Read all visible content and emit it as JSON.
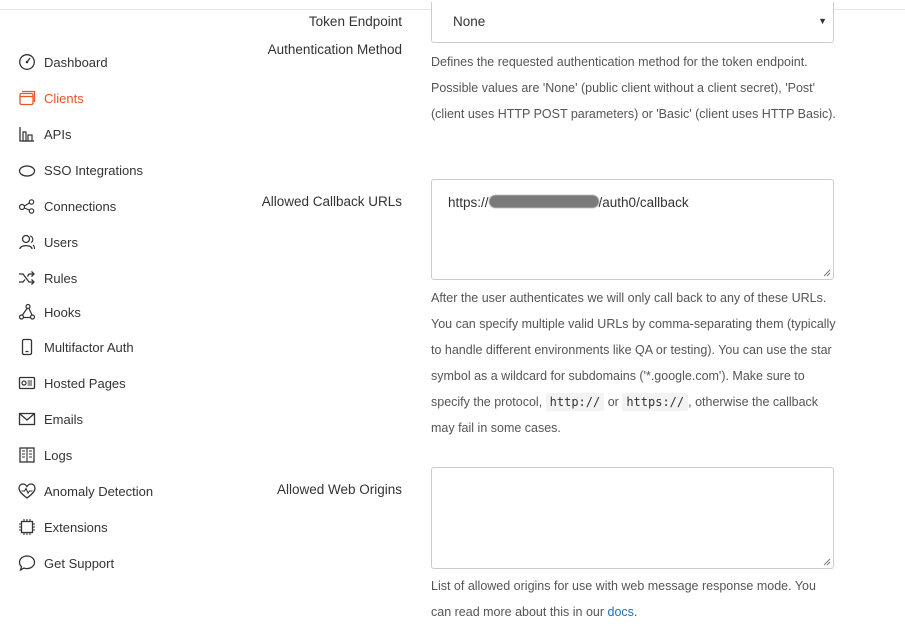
{
  "nav": {
    "dashboard": "Dashboard",
    "clients": "Clients",
    "apis": "APIs",
    "sso": "SSO Integrations",
    "connections": "Connections",
    "users": "Users",
    "rules": "Rules",
    "hooks": "Hooks",
    "multifactor": "Multifactor Auth",
    "hosted_pages": "Hosted Pages",
    "emails": "Emails",
    "logs": "Logs",
    "anomaly": "Anomaly Detection",
    "extensions": "Extensions",
    "support": "Get Support"
  },
  "colors": {
    "active_nav": "#eb5424",
    "link": "#1f6fb5"
  },
  "token_endpoint": {
    "label_line1": "Token Endpoint",
    "label_line2": "Authentication Method",
    "selected": "None",
    "help": "Defines the requested authentication method for the token endpoint. Possible values are 'None' (public client without a client secret), 'Post' (client uses HTTP POST parameters) or 'Basic' (client uses HTTP Basic)."
  },
  "callbacks": {
    "label": "Allowed Callback URLs",
    "value_prefix": "https://",
    "value_suffix": "/auth0/callback",
    "help_part1": "After the user authenticates we will only call back to any of these URLs. You can specify multiple valid URLs by comma-separating them (typically to handle different environments like QA or testing). You can use the star symbol as a wildcard for subdomains ('*.google.com'). Make sure to specify the protocol,",
    "code_http": "http://",
    "or": "or",
    "code_https": "https://",
    "help_part2": ", otherwise the callback may fail in some cases."
  },
  "web_origins": {
    "label": "Allowed Web Origins",
    "value": "",
    "help_text": "List of allowed origins for use with web message response mode. You can read more about this in our",
    "link": "docs",
    "end": "."
  }
}
